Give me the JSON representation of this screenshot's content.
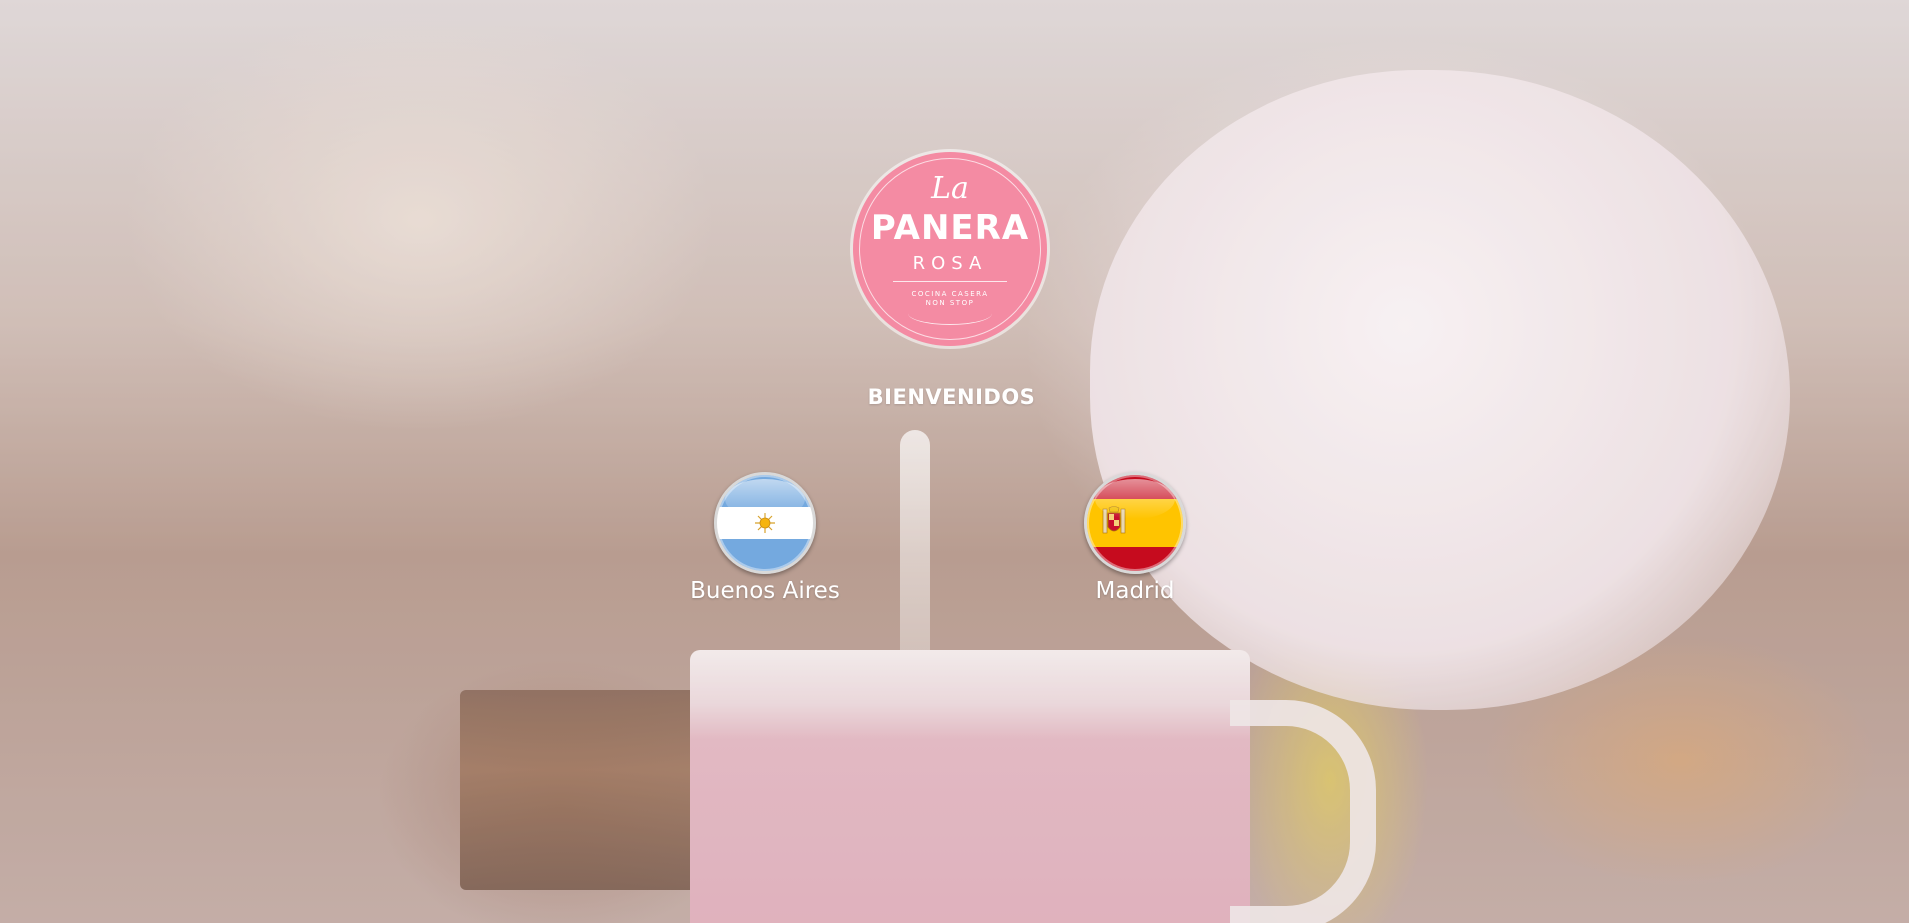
{
  "logo": {
    "line1": "La",
    "line2": "PANERA",
    "line3": "ROSA",
    "tagline_1": "COCINA CASERA",
    "tagline_2": "NON STOP",
    "color": "#f48ba3"
  },
  "welcome": "BIENVENIDOS",
  "locations": [
    {
      "label": "Buenos Aires",
      "flag": "argentina-flag-icon"
    },
    {
      "label": "Madrid",
      "flag": "spain-flag-icon"
    }
  ],
  "colors": {
    "text": "#ffffff",
    "argentina_blue": "#74a9df",
    "spain_red": "#c60b1e",
    "spain_yellow": "#ffc400"
  }
}
